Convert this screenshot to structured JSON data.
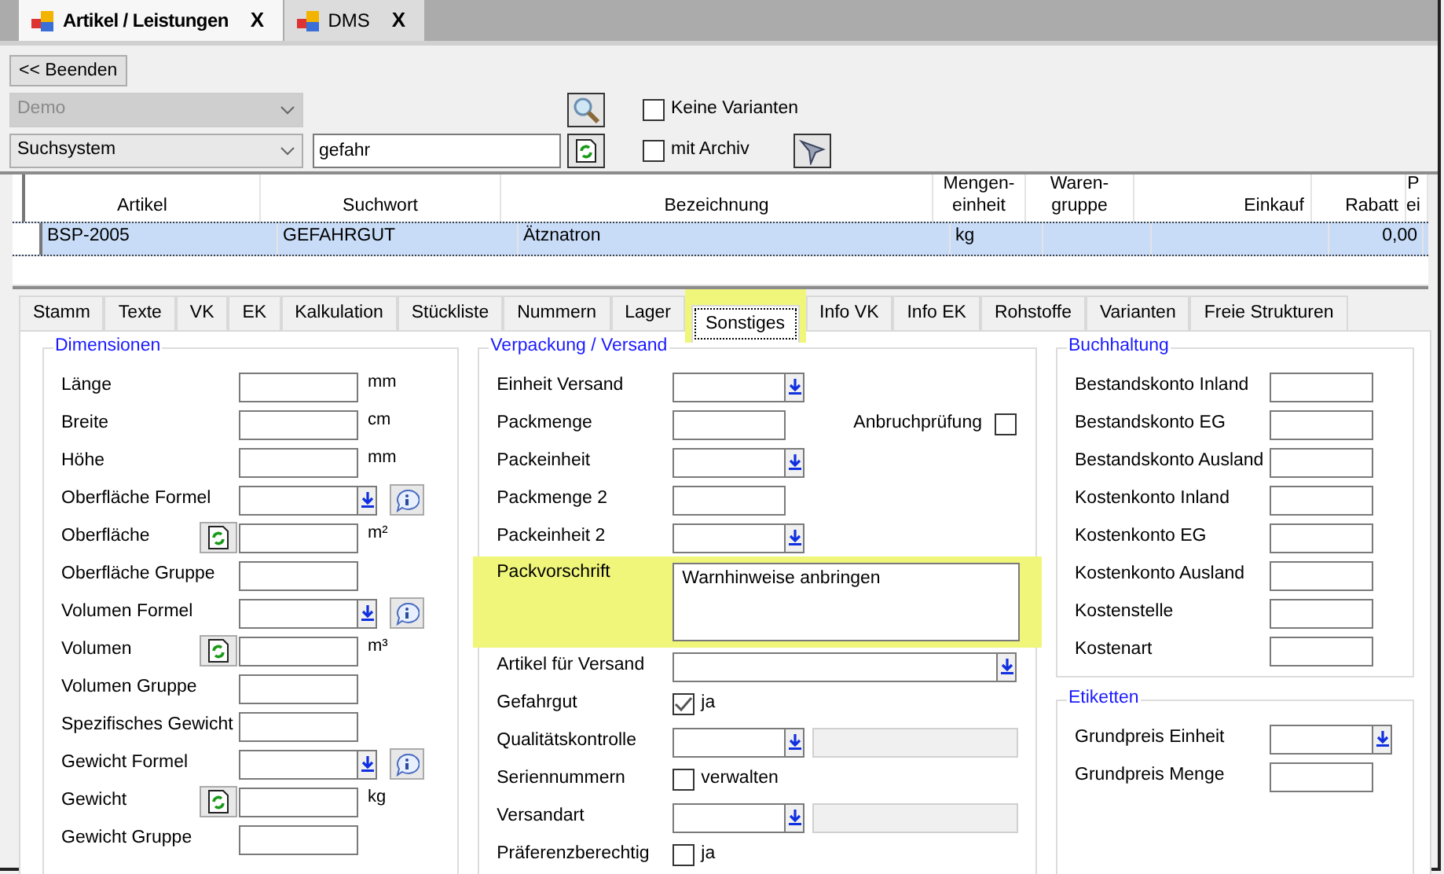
{
  "document_tabs": [
    {
      "label": "Artikel / Leistungen",
      "selected": true,
      "close": "X"
    },
    {
      "label": "DMS",
      "selected": false,
      "close": "X"
    }
  ],
  "toolbar": {
    "exit_button": "<< Beenden",
    "client_select": {
      "value": "Demo",
      "disabled": true
    },
    "search_system": {
      "value": "Suchsystem",
      "disabled": false
    },
    "search_field": {
      "value": "gefahr"
    },
    "options": [
      {
        "label": "Keine Varianten",
        "checked": false
      },
      {
        "label": "mit Archiv",
        "checked": false
      }
    ]
  },
  "table": {
    "columns": [
      "Artikel",
      "Suchwort",
      "Bezeichnung",
      "Mengen-\neinheit",
      "Waren-\ngruppe",
      "Einkauf",
      "Rabatt",
      "P\nei"
    ],
    "rows": [
      {
        "cells": [
          "BSP-2005",
          "GEFAHRGUT",
          "Ätznatron",
          "kg",
          null,
          null,
          "0,00",
          null
        ],
        "selected": true
      }
    ]
  },
  "detail_tabs": [
    {
      "label": "Stamm",
      "selected": false,
      "highlighted": false
    },
    {
      "label": "Texte",
      "selected": false,
      "highlighted": false
    },
    {
      "label": "VK",
      "selected": false,
      "highlighted": false
    },
    {
      "label": "EK",
      "selected": false,
      "highlighted": false
    },
    {
      "label": "Kalkulation",
      "selected": false,
      "highlighted": false
    },
    {
      "label": "Stückliste",
      "selected": false,
      "highlighted": false
    },
    {
      "label": "Nummern",
      "selected": false,
      "highlighted": false
    },
    {
      "label": "Lager",
      "selected": false,
      "highlighted": false
    },
    {
      "label": "Sonstiges",
      "selected": true,
      "highlighted": true
    },
    {
      "label": "Info VK",
      "selected": false,
      "highlighted": false
    },
    {
      "label": "Info EK",
      "selected": false,
      "highlighted": false
    },
    {
      "label": "Rohstoffe",
      "selected": false,
      "highlighted": false
    },
    {
      "label": "Varianten",
      "selected": false,
      "highlighted": false
    },
    {
      "label": "Freie Strukturen",
      "selected": false,
      "highlighted": false
    }
  ],
  "groups": [
    {
      "title": "Dimensionen",
      "fields": [
        {
          "label": "Länge",
          "kind": "text",
          "unit": "mm"
        },
        {
          "label": "Breite",
          "kind": "text",
          "unit": "cm"
        },
        {
          "label": "Höhe",
          "kind": "text",
          "unit": "mm"
        },
        {
          "label": "Oberfläche Formel",
          "kind": "combo_info"
        },
        {
          "label": "Oberfläche",
          "kind": "calc",
          "unit": "m²"
        },
        {
          "label": "Oberfläche Gruppe",
          "kind": "text"
        },
        {
          "label": "Volumen Formel",
          "kind": "combo_info"
        },
        {
          "label": "Volumen",
          "kind": "calc",
          "unit": "m³"
        },
        {
          "label": "Volumen Gruppe",
          "kind": "text"
        },
        {
          "label": "Spezifisches Gewicht",
          "kind": "text"
        },
        {
          "label": "Gewicht Formel",
          "kind": "combo_info"
        },
        {
          "label": "Gewicht",
          "kind": "calc",
          "unit": "kg"
        },
        {
          "label": "Gewicht Gruppe",
          "kind": "text"
        }
      ]
    },
    {
      "title": "Verpackung / Versand",
      "fields": [
        {
          "label": "Einheit Versand",
          "kind": "combo"
        },
        {
          "label": "Packmenge",
          "kind": "text",
          "side_check": {
            "label": "Anbruchprüfung",
            "checked": false
          }
        },
        {
          "label": "Packeinheit",
          "kind": "combo"
        },
        {
          "label": "Packmenge 2",
          "kind": "text"
        },
        {
          "label": "Packeinheit 2",
          "kind": "combo"
        },
        {
          "label": "Packvorschrift",
          "kind": "memo",
          "value": "Warnhinweise anbringen",
          "highlighted": true
        },
        {
          "label": "Artikel für Versand",
          "kind": "combo_wide"
        },
        {
          "label": "Gefahrgut",
          "kind": "check",
          "text": "ja",
          "checked": true
        },
        {
          "label": "Qualitätskontrolle",
          "kind": "combo_extra"
        },
        {
          "label": "Seriennummern",
          "kind": "check",
          "text": "verwalten",
          "checked": false
        },
        {
          "label": "Versandart",
          "kind": "combo_extra"
        },
        {
          "label": "Präferenzberechtig",
          "kind": "check",
          "text": "ja",
          "checked": false
        }
      ]
    },
    {
      "title": "Buchhaltung",
      "fields": [
        {
          "label": "Bestandskonto Inland",
          "kind": "text"
        },
        {
          "label": "Bestandskonto EG",
          "kind": "text"
        },
        {
          "label": "Bestandskonto Ausland",
          "kind": "text"
        },
        {
          "label": "Kostenkonto Inland",
          "kind": "text"
        },
        {
          "label": "Kostenkonto EG",
          "kind": "text"
        },
        {
          "label": "Kostenkonto Ausland",
          "kind": "text"
        },
        {
          "label": "Kostenstelle",
          "kind": "text"
        },
        {
          "label": "Kostenart",
          "kind": "text"
        }
      ]
    },
    {
      "title": "Etiketten",
      "fields": [
        {
          "label": "Grundpreis Einheit",
          "kind": "combo"
        },
        {
          "label": "Grundpreis Menge",
          "kind": "text"
        }
      ]
    }
  ]
}
